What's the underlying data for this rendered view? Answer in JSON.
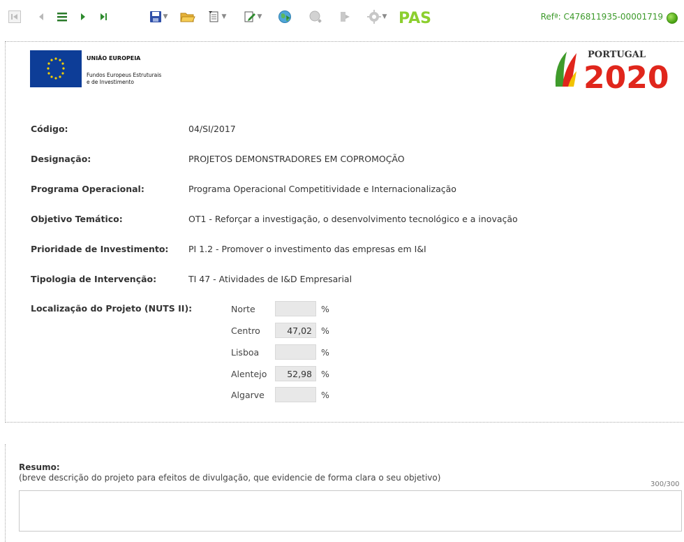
{
  "toolbar": {
    "items": [
      "first-record",
      "previous-record",
      "list",
      "next-record",
      "last-record",
      "save",
      "open",
      "new-document",
      "edit",
      "globe",
      "search",
      "exit",
      "settings",
      "pas-logo"
    ],
    "pas_text": "PAS",
    "reference_text": "Refª: C476811935-00001719",
    "status_color": "#46a010"
  },
  "header": {
    "eu_title": "UNIÃO EUROPEIA",
    "eu_subtitle_1": "Fundos Europeus Estruturais",
    "eu_subtitle_2": "e de Investimento",
    "logo_small": "PORTUGAL",
    "logo_big": "2020"
  },
  "fields": [
    {
      "label": "Código:",
      "value": "04/SI/2017"
    },
    {
      "label": "Designação:",
      "value": "PROJETOS DEMONSTRADORES EM COPROMOÇÃO"
    },
    {
      "label": "Programa Operacional:",
      "value": "Programa Operacional Competitividade e Internacionalização"
    },
    {
      "label": "Objetivo Temático:",
      "value": "OT1 - Reforçar a investigação, o desenvolvimento tecnológico e a inovação"
    },
    {
      "label": "Prioridade de Investimento:",
      "value": "PI 1.2 - Promover o investimento das empresas em I&I"
    },
    {
      "label": "Tipologia de Intervenção:",
      "value": "TI 47 - Atividades de I&D Empresarial"
    }
  ],
  "location": {
    "label": "Localização do Projeto (NUTS II):",
    "unit": "%",
    "regions": [
      {
        "name": "Norte",
        "value": ""
      },
      {
        "name": "Centro",
        "value": "47,02"
      },
      {
        "name": "Lisboa",
        "value": ""
      },
      {
        "name": "Alentejo",
        "value": "52,98"
      },
      {
        "name": "Algarve",
        "value": ""
      }
    ]
  },
  "resumo": {
    "title": "Resumo:",
    "hint": "(breve descrição do projeto para efeitos de divulgação, que evidencie de forma clara o seu objetivo)",
    "counter": "300/300",
    "value": ""
  }
}
